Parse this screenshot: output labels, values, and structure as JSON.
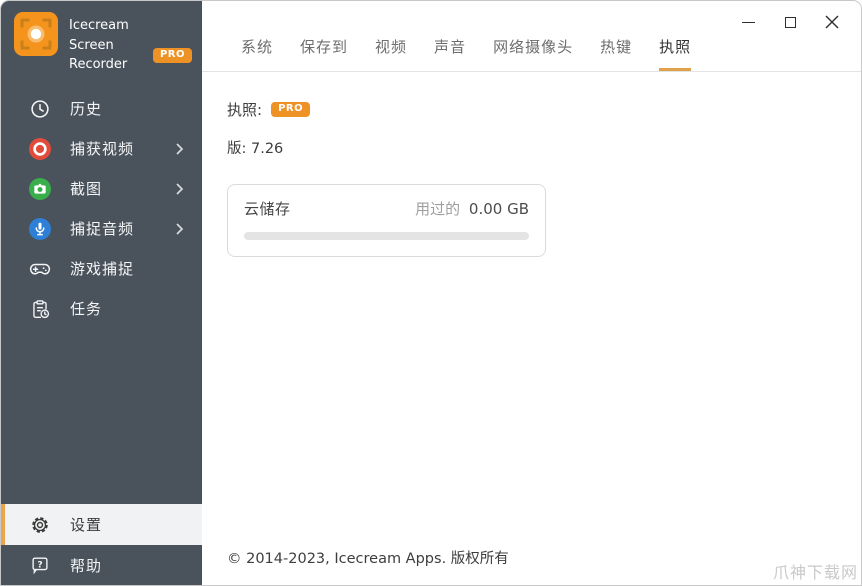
{
  "app": {
    "title_line1": "Icecream",
    "title_line2": "Screen Recorder",
    "pro_badge": "PRO",
    "logo_icon": "viewfinder-record-icon"
  },
  "window_controls": {
    "minimize_icon": "minimize-icon",
    "maximize_icon": "maximize-icon",
    "close_icon": "close-icon"
  },
  "sidebar": {
    "items": [
      {
        "label": "历史",
        "icon": "clock-icon",
        "chevron": false
      },
      {
        "label": "捕获视频",
        "icon": "record-icon",
        "chevron": true
      },
      {
        "label": "截图",
        "icon": "camera-icon",
        "chevron": true
      },
      {
        "label": "捕捉音频",
        "icon": "microphone-icon",
        "chevron": true
      },
      {
        "label": "游戏捕捉",
        "icon": "gamepad-icon",
        "chevron": false
      },
      {
        "label": "任务",
        "icon": "tasks-icon",
        "chevron": false
      }
    ],
    "bottom_items": [
      {
        "label": "设置",
        "icon": "gear-icon",
        "active": true
      },
      {
        "label": "帮助",
        "icon": "help-icon",
        "active": false
      }
    ]
  },
  "tabs": [
    {
      "label": "系统",
      "active": false
    },
    {
      "label": "保存到",
      "active": false
    },
    {
      "label": "视频",
      "active": false
    },
    {
      "label": "声音",
      "active": false
    },
    {
      "label": "网络摄像头",
      "active": false
    },
    {
      "label": "热键",
      "active": false
    },
    {
      "label": "执照",
      "active": true
    }
  ],
  "main": {
    "license_label": "执照:",
    "license_badge": "PRO",
    "version_text": "版: 7.26",
    "storage_card": {
      "title": "云储存",
      "used_label": "用过的",
      "used_value": "0.00 GB",
      "progress_percent": 0
    },
    "footer_text": "© 2014-2023, Icecream Apps. 版权所有"
  },
  "watermark_text": "爪神下载网",
  "colors": {
    "accent_orange": "#ef9226",
    "tab_underline": "#dfa14b",
    "sidebar_bg": "#4a535c",
    "active_item_bg": "#f1f2f3",
    "active_item_border": "#e9a44f",
    "record_red": "#e14b3c",
    "camera_green": "#3bae4c",
    "mic_blue": "#2e7fd6",
    "progress_track": "#e4e4e4",
    "card_border": "#dbdbdb",
    "watermark_gray": "#c9c9c9"
  }
}
